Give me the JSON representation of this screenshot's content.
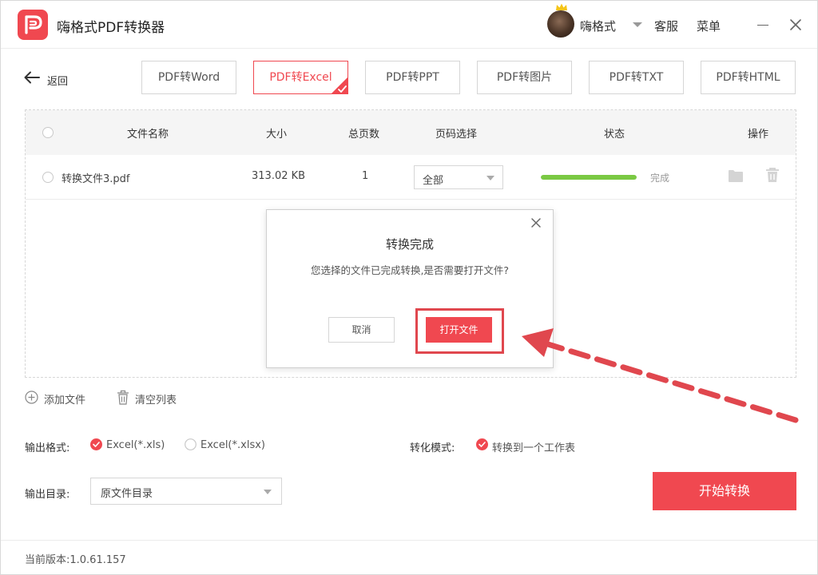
{
  "app": {
    "title": "嗨格式PDF转换器",
    "user_name": "嗨格式",
    "support": "客服",
    "menu": "菜单"
  },
  "nav": {
    "back_label": "返回",
    "tabs": [
      {
        "label": "PDF转Word",
        "active": false
      },
      {
        "label": "PDF转Excel",
        "active": true
      },
      {
        "label": "PDF转PPT",
        "active": false
      },
      {
        "label": "PDF转图片",
        "active": false
      },
      {
        "label": "PDF转TXT",
        "active": false
      },
      {
        "label": "PDF转HTML",
        "active": false
      }
    ]
  },
  "table": {
    "headers": {
      "name": "文件名称",
      "size": "大小",
      "pages": "总页数",
      "page_select": "页码选择",
      "status": "状态",
      "actions": "操作"
    },
    "rows": [
      {
        "name": "转换文件3.pdf",
        "size": "313.02 KB",
        "pages": "1",
        "page_select": "全部",
        "progress": 1.0,
        "status": "完成"
      }
    ]
  },
  "dialog": {
    "title": "转换完成",
    "message": "您选择的文件已完成转换,是否需要打开文件?",
    "cancel": "取消",
    "open": "打开文件"
  },
  "actions": {
    "add_file": "添加文件",
    "clear_list": "清空列表"
  },
  "options": {
    "output_format_label": "输出格式:",
    "format_xls": "Excel(*.xls)",
    "format_xlsx": "Excel(*.xlsx)",
    "selected_format": "xls",
    "convert_mode_label": "转化模式:",
    "convert_mode": "转换到一个工作表",
    "output_dir_label": "输出目录:",
    "output_dir": "原文件目录"
  },
  "start_button": "开始转换",
  "footer": {
    "version": "当前版本:1.0.61.157"
  },
  "colors": {
    "accent": "#f04850",
    "progress": "#7ac943"
  }
}
